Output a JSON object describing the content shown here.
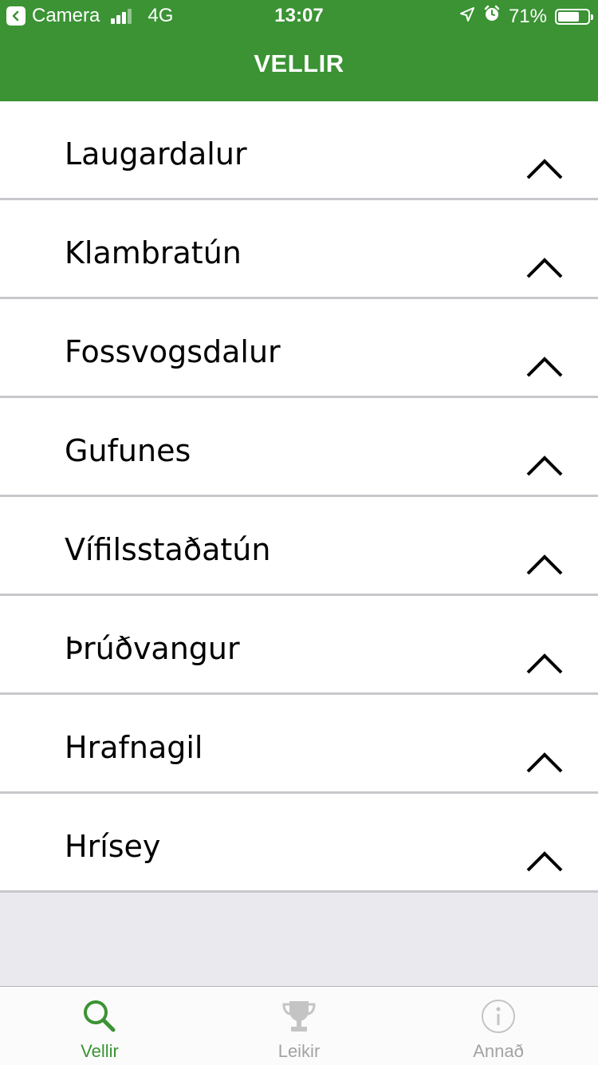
{
  "status_bar": {
    "back_app": "Camera",
    "network": "4G",
    "time": "13:07",
    "battery": "71%",
    "battery_level": 0.71
  },
  "header": {
    "title": "VELLIR"
  },
  "venues": [
    {
      "label": "Laugardalur"
    },
    {
      "label": "Klambratún"
    },
    {
      "label": "Fossvogsdalur"
    },
    {
      "label": "Gufunes"
    },
    {
      "label": "Vífilsstaðatún"
    },
    {
      "label": "Þrúðvangur"
    },
    {
      "label": "Hrafnagil"
    },
    {
      "label": "Hrísey"
    }
  ],
  "tabs": [
    {
      "label": "Vellir",
      "icon": "search-icon",
      "active": true
    },
    {
      "label": "Leikir",
      "icon": "trophy-icon",
      "active": false
    },
    {
      "label": "Annað",
      "icon": "info-icon",
      "active": false
    }
  ],
  "colors": {
    "accent": "#3b9334",
    "inactive": "#a3a3a3",
    "background": "#e9e9ee"
  }
}
